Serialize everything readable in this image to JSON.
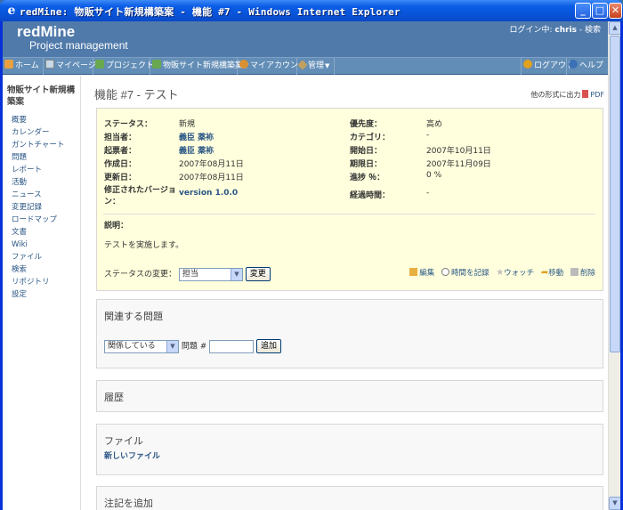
{
  "window": {
    "title": "redMine: 物販サイト新規構築案 - 機能 #7 - Windows Internet Explorer"
  },
  "header": {
    "logo": "redMine",
    "subtitle": "Project management",
    "logged_in_label": "ログイン中:",
    "user": "chris",
    "search_label": "- 検索"
  },
  "menu": {
    "home": "ホーム",
    "mypage": "マイページ",
    "projects": "プロジェクト",
    "current_project": "物販サイト新規構築案",
    "my_account": "マイアカウント",
    "admin": "管理",
    "logout": "ログアウト",
    "help": "ヘルプ"
  },
  "sidebar": {
    "project_name": "物販サイト新規構築案",
    "items": [
      "概要",
      "カレンダー",
      "ガントチャート",
      "問題",
      "レポート",
      "活動",
      "ニュース",
      "変更記録",
      "ロードマップ",
      "文書",
      "Wiki",
      "ファイル",
      "検索",
      "リポジトリ",
      "設定"
    ]
  },
  "issue": {
    "title": "機能 #7 - テスト",
    "other_formats_label": "他の形式に出力",
    "pdf_label": "PDF",
    "left_attrs": [
      {
        "label": "ステータス：",
        "value": "新規"
      },
      {
        "label": "担当者：",
        "value": "義臣 薬袮"
      },
      {
        "label": "起票者：",
        "value": "義臣 薬袮"
      },
      {
        "label": "作成日：",
        "value": "2007年08月11日"
      },
      {
        "label": "更新日：",
        "value": "2007年08月11日"
      },
      {
        "label": "修正されたバージョン：",
        "value": "version 1.0.0"
      }
    ],
    "right_attrs": [
      {
        "label": "優先度：",
        "value": "高め"
      },
      {
        "label": "カテゴリ：",
        "value": "-"
      },
      {
        "label": "開始日：",
        "value": "2007年10月11日"
      },
      {
        "label": "期限日：",
        "value": "2007年11月09日"
      },
      {
        "label": "進捗 ％：",
        "value": "0 %"
      },
      {
        "label": "経過時間：",
        "value": "-"
      }
    ],
    "description_label": "説明：",
    "description": "テストを実施します。",
    "status_change_label": "ステータスの変更：",
    "status_select_value": "担当",
    "change_button": "変更",
    "actions": {
      "edit": "編集",
      "log_time": "時間を記録",
      "watch": "ウォッチ",
      "move": "移動",
      "delete": "削除"
    }
  },
  "related": {
    "heading": "関連する問題",
    "relation_select_value": "関係している",
    "issue_label": "問題 #",
    "add_button": "追加"
  },
  "history": {
    "heading": "履歴"
  },
  "files": {
    "heading": "ファイル",
    "new_file": "新しいファイル"
  },
  "notes": {
    "heading": "注記を追加"
  }
}
